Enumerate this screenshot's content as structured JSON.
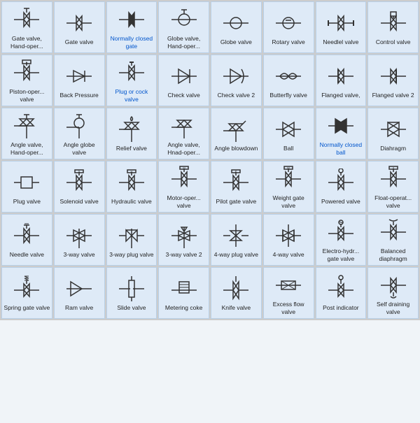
{
  "cells": [
    {
      "id": "gate-valve-hand",
      "label": "Gate valve, Hand-oper...",
      "blue": false
    },
    {
      "id": "gate-valve",
      "label": "Gate valve",
      "blue": false
    },
    {
      "id": "normally-closed-gate",
      "label": "Normally closed gate",
      "blue": true
    },
    {
      "id": "globe-valve-hand",
      "label": "Globe valve, Hand-oper...",
      "blue": false
    },
    {
      "id": "globe-valve",
      "label": "Globe valve",
      "blue": false
    },
    {
      "id": "rotary-valve",
      "label": "Rotary valve",
      "blue": false
    },
    {
      "id": "needle-valve-flanged",
      "label": "Needlel valve",
      "blue": false
    },
    {
      "id": "control-valve",
      "label": "Control valve",
      "blue": false
    },
    {
      "id": "piston-valve",
      "label": "Piston-oper... valve",
      "blue": false
    },
    {
      "id": "back-pressure",
      "label": "Back Pressure",
      "blue": false
    },
    {
      "id": "plug-or-cock",
      "label": "Plug or cock valve",
      "blue": true
    },
    {
      "id": "check-valve",
      "label": "Check valve",
      "blue": false
    },
    {
      "id": "check-valve-2",
      "label": "Check valve 2",
      "blue": false
    },
    {
      "id": "butterfly-valve",
      "label": "Butterfly valve",
      "blue": false
    },
    {
      "id": "flanged-valve",
      "label": "Flanged valve,",
      "blue": false
    },
    {
      "id": "flanged-valve-2",
      "label": "Flanged valve 2",
      "blue": false
    },
    {
      "id": "angle-valve-hand",
      "label": "Angle valve, Hand-oper...",
      "blue": false
    },
    {
      "id": "angle-globe",
      "label": "Angle globe valve",
      "blue": false
    },
    {
      "id": "relief-valve",
      "label": "Relief valve",
      "blue": false
    },
    {
      "id": "angle-valve-hnad",
      "label": "Angle valve, Hnad-oper...",
      "blue": false
    },
    {
      "id": "angle-blowdown",
      "label": "Angle blowdown",
      "blue": false
    },
    {
      "id": "ball-valve",
      "label": "Ball",
      "blue": false
    },
    {
      "id": "normally-closed-ball",
      "label": "Normally closed ball",
      "blue": true
    },
    {
      "id": "diaphragm",
      "label": "Diahragm",
      "blue": false
    },
    {
      "id": "plug-valve",
      "label": "Plug valve",
      "blue": false
    },
    {
      "id": "solenoid-valve",
      "label": "Solenoid valve",
      "blue": false
    },
    {
      "id": "hydraulic-valve",
      "label": "Hydraulic valve",
      "blue": false
    },
    {
      "id": "motor-oper-valve",
      "label": "Motor-oper... valve",
      "blue": false
    },
    {
      "id": "pilot-gate-valve",
      "label": "Pilot gate valve",
      "blue": false
    },
    {
      "id": "weight-gate-valve",
      "label": "Weight gate valve",
      "blue": false
    },
    {
      "id": "powered-valve",
      "label": "Powered valve",
      "blue": false
    },
    {
      "id": "float-oper-valve",
      "label": "Float-operat... valve",
      "blue": false
    },
    {
      "id": "needle-valve",
      "label": "Needle valve",
      "blue": false
    },
    {
      "id": "3way-valve",
      "label": "3-way valve",
      "blue": false
    },
    {
      "id": "3way-plug-valve",
      "label": "3-way plug valve",
      "blue": false
    },
    {
      "id": "3way-valve-2",
      "label": "3-way valve 2",
      "blue": false
    },
    {
      "id": "4way-plug-valve",
      "label": "4-way plug valve",
      "blue": false
    },
    {
      "id": "4way-valve",
      "label": "4-way valve",
      "blue": false
    },
    {
      "id": "electro-hydr-gate",
      "label": "Electro-hydr... gate valve",
      "blue": false
    },
    {
      "id": "balanced-diaphragm",
      "label": "Balanced diaphragm",
      "blue": false
    },
    {
      "id": "spring-gate-valve",
      "label": "Spring gate valve",
      "blue": false
    },
    {
      "id": "ram-valve",
      "label": "Ram valve",
      "blue": false
    },
    {
      "id": "slide-valve",
      "label": "Slide valve",
      "blue": false
    },
    {
      "id": "metering-coke",
      "label": "Metering coke",
      "blue": false
    },
    {
      "id": "knife-valve",
      "label": "Knife valve",
      "blue": false
    },
    {
      "id": "excess-flow-valve",
      "label": "Excess flow valve",
      "blue": false
    },
    {
      "id": "post-indicator",
      "label": "Post indicator",
      "blue": false
    },
    {
      "id": "self-draining-valve",
      "label": "Self draining valve",
      "blue": false
    }
  ]
}
